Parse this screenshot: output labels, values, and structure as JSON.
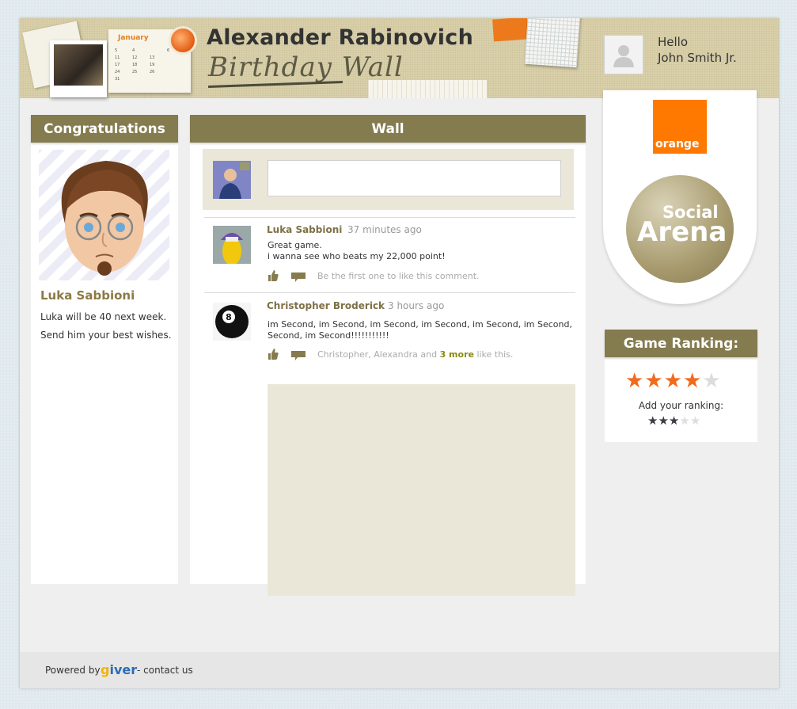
{
  "header": {
    "title": "Alexander Rabinovich",
    "subtitle": "Birthday Wall",
    "calendar_month": "January",
    "calendar_days": [
      "5",
      "4",
      "5",
      "6",
      "11",
      "12",
      "13",
      "17",
      "18",
      "19",
      "24",
      "25",
      "26",
      "31"
    ]
  },
  "user": {
    "greeting": "Hello",
    "name": "John Smith Jr."
  },
  "congrats": {
    "header": "Congratulations",
    "name": "Luka Sabbioni",
    "text_prefix": "Luka will be ",
    "age": "40",
    "text_suffix": " next week.",
    "wishes": "Send him your best wishes."
  },
  "wall": {
    "header": "Wall",
    "input_value": "",
    "posts": [
      {
        "author": "Luka Sabbioni",
        "time": "37 minutes ago",
        "body_line1": "Great game.",
        "body_line2": "i wanna see who beats my 22,000 point!",
        "likes_text": "Be the first one to like this comment."
      },
      {
        "author": "Christopher Broderick",
        "time": "3 hours ago",
        "body": "im Second, im Second, im Second, im Second, im Second, im Second, Second, im Second!!!!!!!!!!!",
        "likes_prefix": "Christopher, Alexandra and ",
        "likes_more": "3 more",
        "likes_suffix": " like this."
      }
    ]
  },
  "sponsor": {
    "brand": "orange",
    "arena_line1": "Social",
    "arena_line2": "Arena"
  },
  "ranking": {
    "header": "Game Ranking:",
    "rating": 4,
    "max": 5,
    "add_label": "Add your ranking:",
    "user_rating": 3
  },
  "footer": {
    "powered_by": "Powered by",
    "brand": "giver",
    "contact": "- contact us"
  },
  "colors": {
    "accent_olive": "#847b4f",
    "star_orange": "#f26b1d",
    "brand_orange": "#ff7900"
  }
}
